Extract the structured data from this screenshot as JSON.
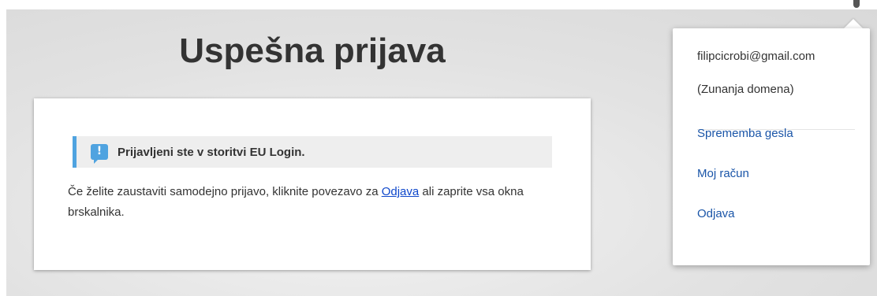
{
  "page": {
    "title": "Uspešna prijava"
  },
  "alert": {
    "icon": "info-exclamation-icon",
    "message": "Prijavljeni ste v storitvi EU Login."
  },
  "body": {
    "text_before": "Če želite zaustaviti samodejno prijavo, kliknite povezavo za ",
    "link_label": "Odjava",
    "text_after": " ali zaprite vsa okna brskalnika."
  },
  "user_menu": {
    "email": "filipcicrobi@gmail.com",
    "domain": "(Zunanja domena)",
    "items": [
      {
        "label": "Sprememba gesla"
      },
      {
        "label": "Moj račun"
      },
      {
        "label": "Odjava"
      }
    ]
  },
  "colors": {
    "accent": "#4fa3e0",
    "link": "#1a55a8"
  }
}
